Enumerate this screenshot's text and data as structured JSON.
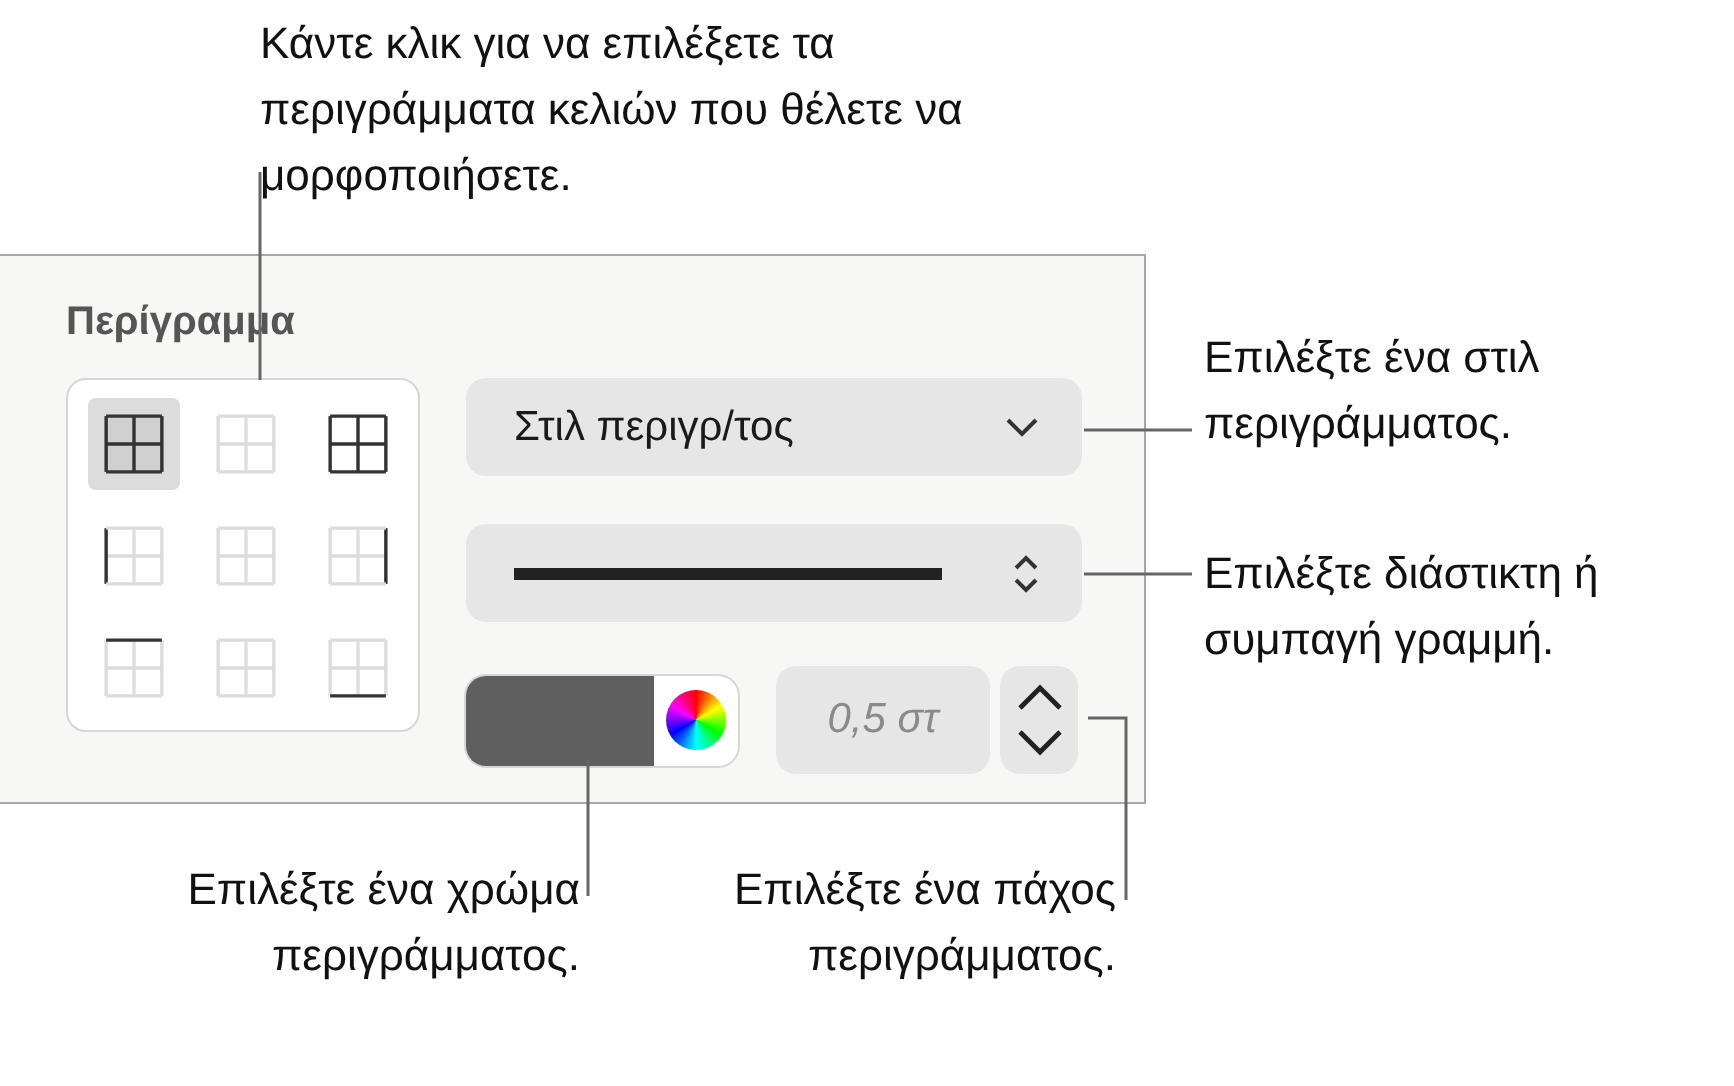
{
  "callouts": [
    {
      "text": "Κάντε κλικ για να επιλέξετε τα περιγράμματα κελιών που θέλετε να μορφοποιήσετε.",
      "kind": "top"
    },
    {
      "text": "Επιλέξτε ένα στιλ περιγράμματος.",
      "kind": "style"
    },
    {
      "text": "Επιλέξτε διάστικτη ή συμπαγή γραμμή.",
      "kind": "line"
    },
    {
      "text": "Επιλέξτε ένα χρώμα περιγράμματος.",
      "kind": "color"
    },
    {
      "text": "Επιλέξτε ένα πάχος περιγράμματος.",
      "kind": "width"
    }
  ],
  "panel": {
    "title": "Περίγραμμα",
    "borders": [
      {
        "kind": "all",
        "selected": true
      },
      {
        "kind": "none",
        "selected": false
      },
      {
        "kind": "all",
        "selected": false
      },
      {
        "kind": "left",
        "selected": false
      },
      {
        "kind": "none",
        "selected": false
      },
      {
        "kind": "right",
        "selected": false
      },
      {
        "kind": "top",
        "selected": false
      },
      {
        "kind": "none",
        "selected": false
      },
      {
        "kind": "bottom",
        "selected": false
      }
    ],
    "style_popup": {
      "label": "Στιλ περιγρ/τος"
    },
    "color": "#5f5f5f",
    "thickness": {
      "value": "0,5 στ"
    }
  }
}
